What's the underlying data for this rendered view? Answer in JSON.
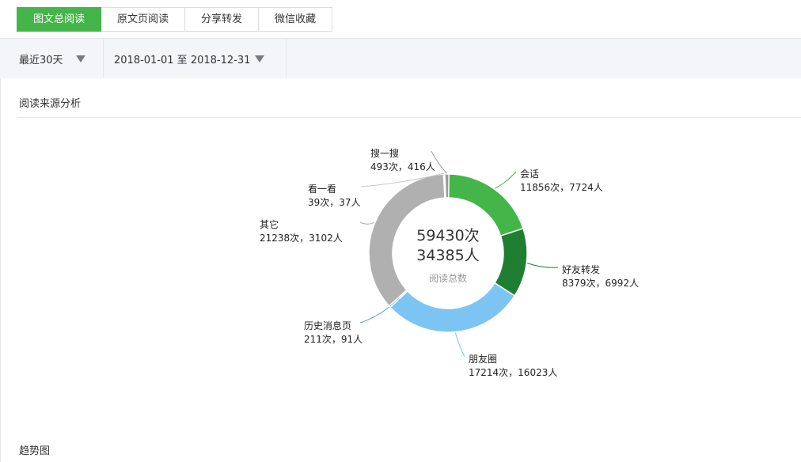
{
  "tabs": [
    {
      "label": "图文总阅读",
      "active": true
    },
    {
      "label": "原文页阅读",
      "active": false
    },
    {
      "label": "分享转发",
      "active": false
    },
    {
      "label": "微信收藏",
      "active": false
    }
  ],
  "filters": {
    "range": "最近30天",
    "dates": "2018-01-01 至 2018-12-31"
  },
  "sections": {
    "source_title": "阅读来源分析",
    "trend_title": "趋势图"
  },
  "chart_data": {
    "type": "pie",
    "center": {
      "reads": "59430次",
      "people": "34385人",
      "caption": "阅读总数"
    },
    "slices": [
      {
        "name": "会话",
        "reads": 11856,
        "people": 7724,
        "detail": "11856次，7724人",
        "color": "#44b549"
      },
      {
        "name": "好友转发",
        "reads": 8379,
        "people": 6992,
        "detail": "8379次，6992人",
        "color": "#207e32"
      },
      {
        "name": "朋友圈",
        "reads": 17214,
        "people": 16023,
        "detail": "17214次，16023人",
        "color": "#7cc5f3"
      },
      {
        "name": "历史消息页",
        "reads": 211,
        "people": 91,
        "detail": "211次，91人",
        "color": "#4aa3dd"
      },
      {
        "name": "其它",
        "reads": 21238,
        "people": 3102,
        "detail": "21238次，3102人",
        "color": "#b0b0b0"
      },
      {
        "name": "看一看",
        "reads": 39,
        "people": 37,
        "detail": "39次，37人",
        "color": "#c8c8c8"
      },
      {
        "name": "搜一搜",
        "reads": 493,
        "people": 416,
        "detail": "493次，416人",
        "color": "#9a9a9a"
      }
    ]
  }
}
